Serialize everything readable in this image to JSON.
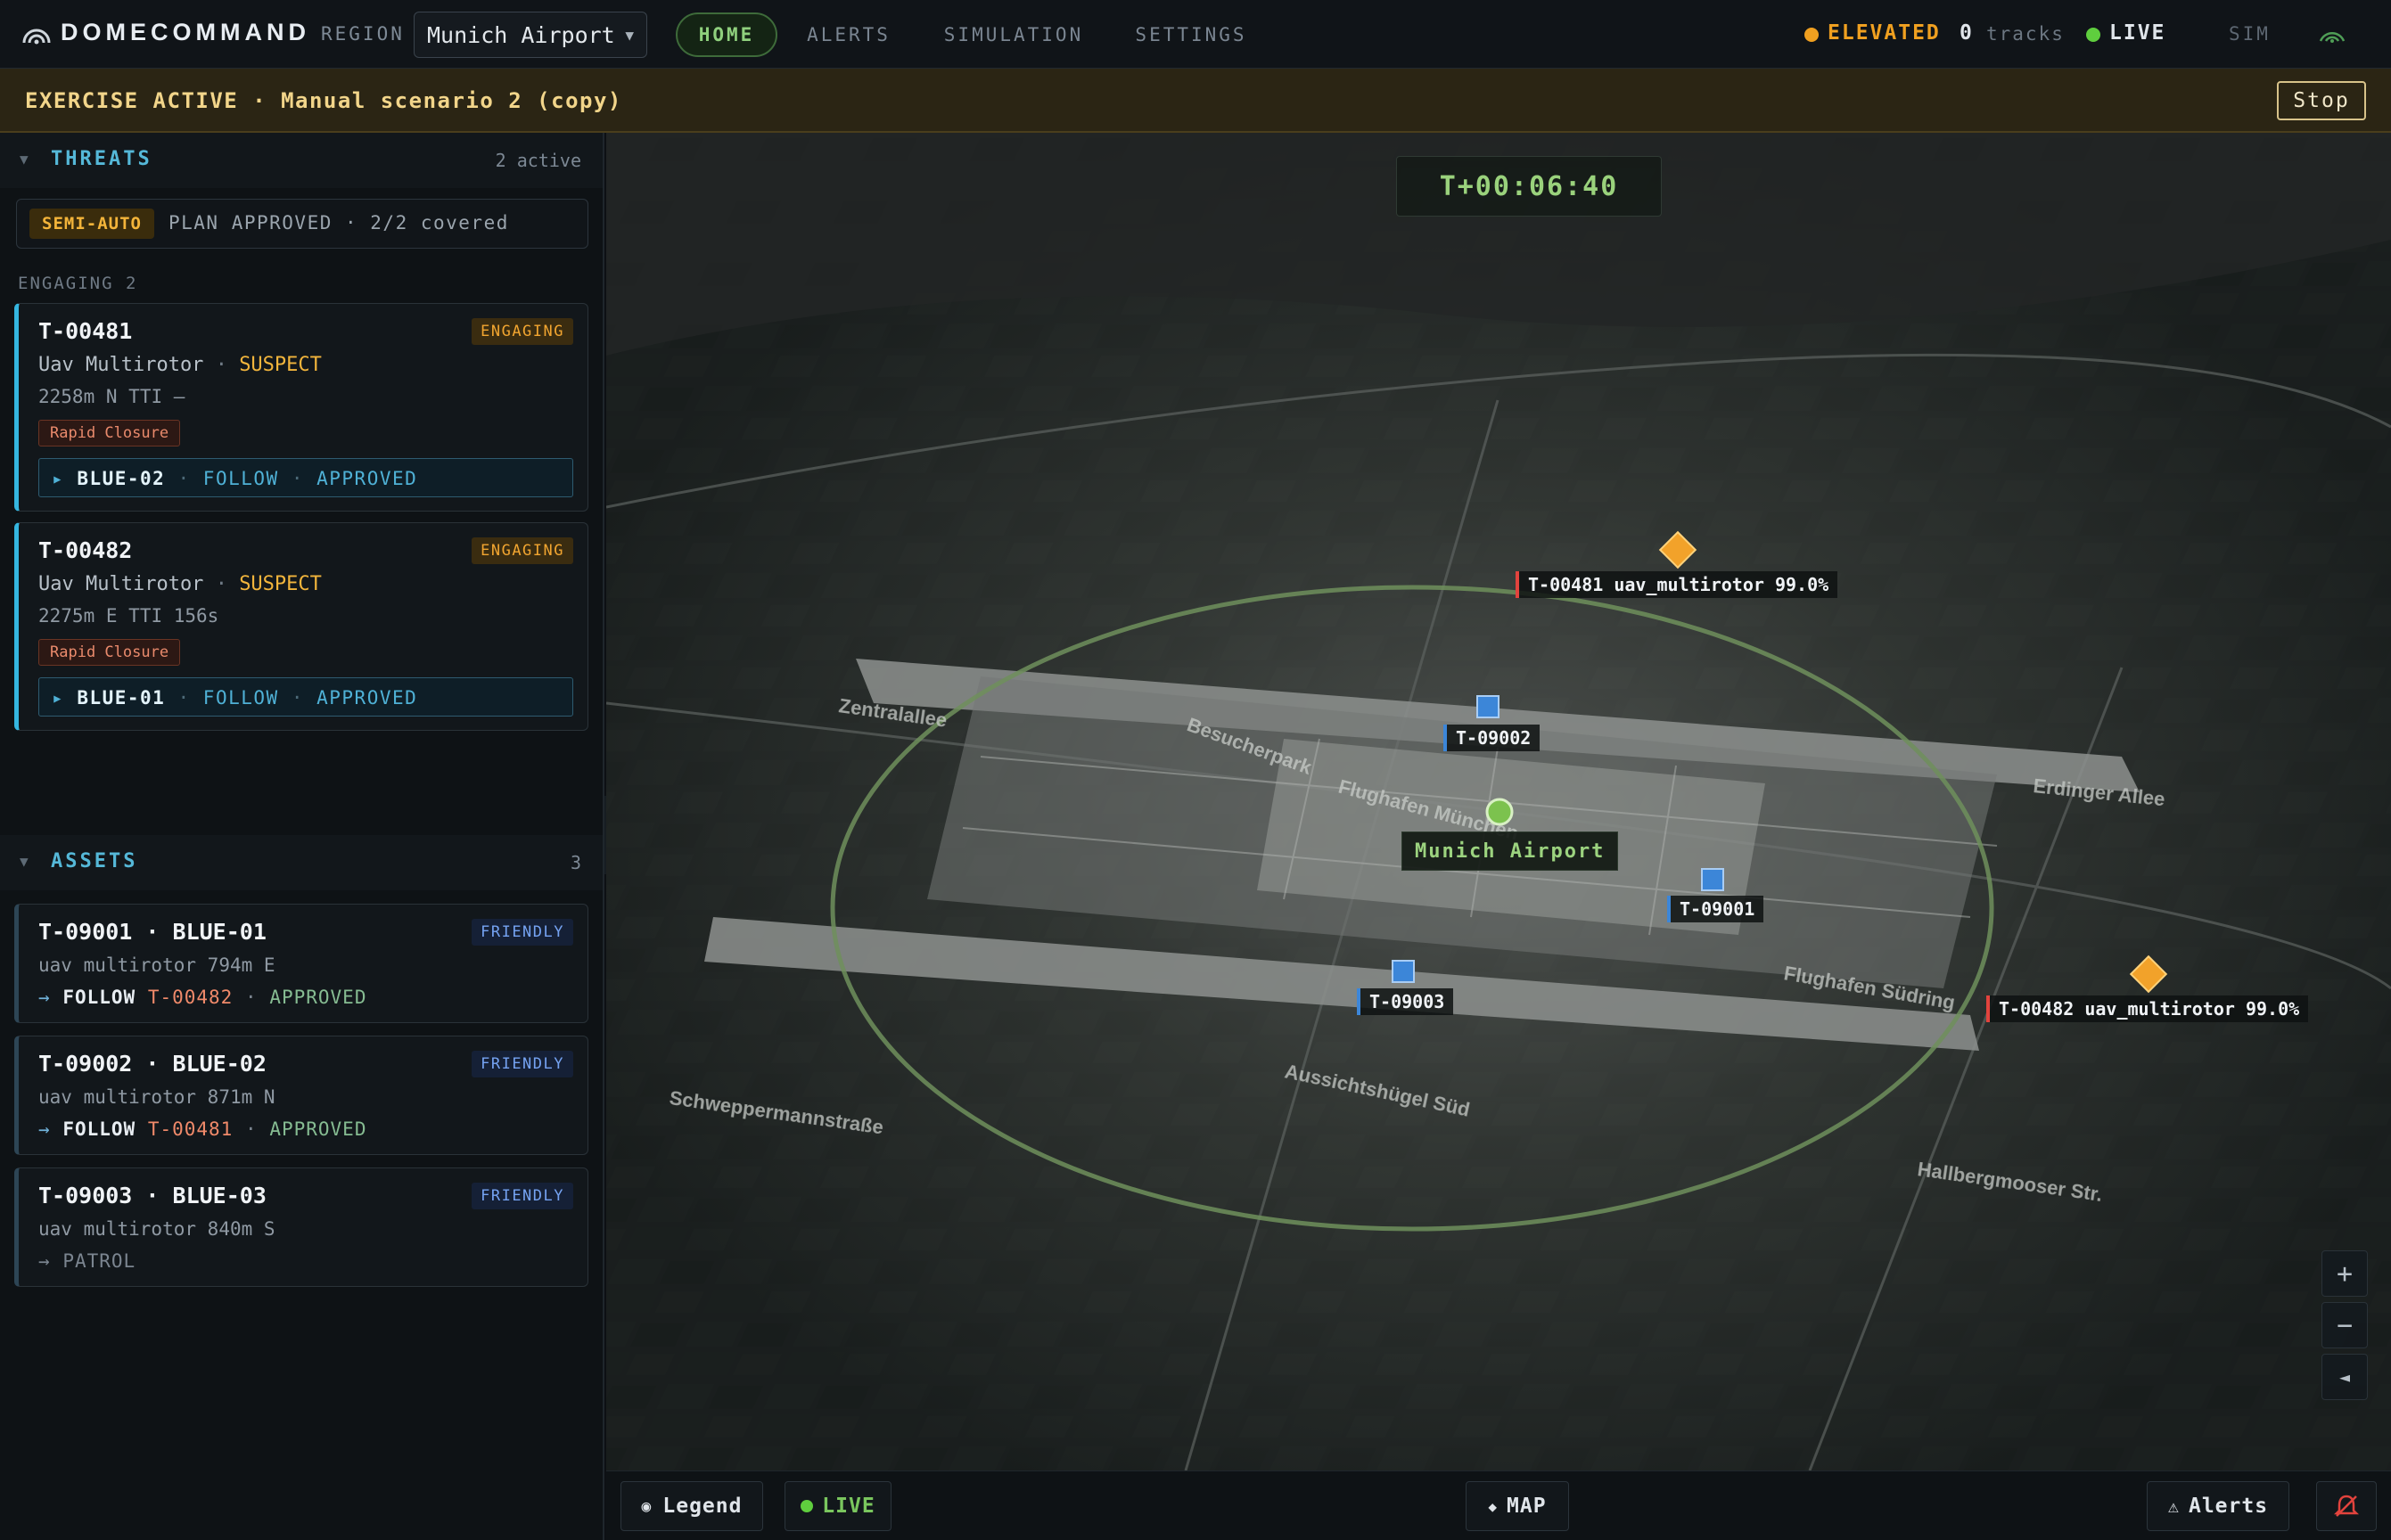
{
  "header": {
    "brand": "DOMECOMMAND",
    "region_label": "REGION",
    "region_value": "Munich Airport",
    "nav_tabs": [
      "HOME",
      "ALERTS",
      "SIMULATION",
      "SETTINGS"
    ],
    "active_tab": "HOME",
    "threat_level": "ELEVATED",
    "track_count": "0",
    "track_label": "tracks",
    "live_label": "LIVE",
    "sim_label": "SIM",
    "colors": {
      "threat": "#f0a020",
      "live": "#5fce3e",
      "accent": "#55b8d8"
    }
  },
  "banner": {
    "text": "EXERCISE ACTIVE · Manual scenario 2 (copy)",
    "stop_label": "Stop"
  },
  "threats": {
    "title": "THREATS",
    "count": "2 active",
    "mode": "SEMI-AUTO",
    "plan_status": "PLAN APPROVED · 2/2 covered",
    "group_label": "ENGAGING 2",
    "items": [
      {
        "id": "T-00481",
        "status": "ENGAGING",
        "type": "Uav Multirotor",
        "classification": "SUSPECT",
        "range": "2258m N",
        "tti": "TTI —",
        "tag": "Rapid Closure",
        "assigned_asset": "BLUE-02",
        "action": "FOLLOW",
        "approval": "APPROVED"
      },
      {
        "id": "T-00482",
        "status": "ENGAGING",
        "type": "Uav Multirotor",
        "classification": "SUSPECT",
        "range": "2275m E",
        "tti": "TTI 156s",
        "tag": "Rapid Closure",
        "assigned_asset": "BLUE-01",
        "action": "FOLLOW",
        "approval": "APPROVED"
      }
    ]
  },
  "assets": {
    "title": "ASSETS",
    "count": "3",
    "items": [
      {
        "id": "T-09001 · BLUE-01",
        "status": "FRIENDLY",
        "type": "uav multirotor",
        "range": "794m E",
        "action": "FOLLOW",
        "target": "T-00482",
        "approval": "APPROVED"
      },
      {
        "id": "T-09002 · BLUE-02",
        "status": "FRIENDLY",
        "type": "uav multirotor",
        "range": "871m N",
        "action": "FOLLOW",
        "target": "T-00481",
        "approval": "APPROVED"
      },
      {
        "id": "T-09003 · BLUE-03",
        "status": "FRIENDLY",
        "type": "uav multirotor",
        "range": "840m S",
        "action": "PATROL"
      }
    ]
  },
  "map": {
    "timer": "T+00:06:40",
    "site_label": "Munich Airport",
    "tracks": [
      {
        "label": "T-00481 uav_multirotor 99.0%",
        "kind": "hostile"
      },
      {
        "label": "T-00482 uav_multirotor 99.0%",
        "kind": "hostile"
      },
      {
        "label": "T-09002",
        "kind": "friendly"
      },
      {
        "label": "T-09001",
        "kind": "friendly"
      },
      {
        "label": "T-09003",
        "kind": "friendly"
      }
    ],
    "map_text": [
      "Aussichtshügel Süd",
      "Flughafen Südring",
      "Hallbergmooser Str.",
      "Erdinger Allee",
      "Flughafen München",
      "Schweppermannstraße",
      "Besucherpark",
      "Zentralallee"
    ]
  },
  "bottombar": {
    "legend": "Legend",
    "live": "LIVE",
    "map": "MAP",
    "alerts": "Alerts"
  }
}
